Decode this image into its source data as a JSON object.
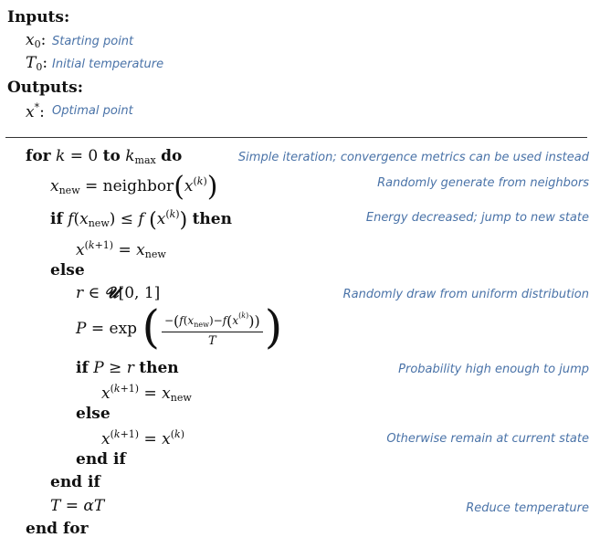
{
  "inputs": {
    "heading": "Inputs:",
    "items": [
      {
        "symbol": "x₀",
        "description": "Starting point"
      },
      {
        "symbol": "T₀",
        "description": "Initial temperature"
      }
    ]
  },
  "outputs": {
    "heading": "Outputs:",
    "items": [
      {
        "symbol": "x*",
        "description": "Optimal point"
      }
    ]
  },
  "keywords": {
    "for": "for",
    "to": "to",
    "do": "do",
    "if": "if",
    "then": "then",
    "else": "else",
    "end_if": "end if",
    "end_for": "end for"
  },
  "comments": {
    "loop": "Simple iteration; convergence metrics can be used instead",
    "neighbor": "Randomly generate from neighbors",
    "energy": "Energy decreased; jump to new state",
    "random": "Randomly draw from uniform distribution",
    "probability": "Probability high enough to jump",
    "remain": "Otherwise remain at current state",
    "temperature": "Reduce temperature"
  }
}
